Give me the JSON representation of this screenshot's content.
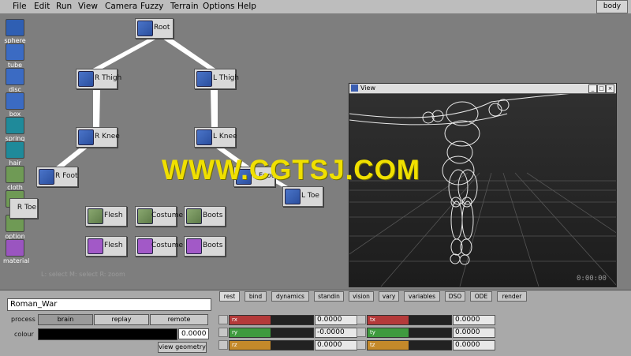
{
  "menu": [
    "File",
    "Edit",
    "Run",
    "View",
    "Camera",
    "Fuzzy",
    "Terrain",
    "Options",
    "Help"
  ],
  "body_button": "body",
  "tools": [
    {
      "label": "sphere",
      "icon": "sphere-icon",
      "color": "#2f5fb3"
    },
    {
      "label": "tube",
      "icon": "tube-icon",
      "color": "#3b6bc3"
    },
    {
      "label": "disc",
      "icon": "disc-icon",
      "color": "#3b6bc3"
    },
    {
      "label": "box",
      "icon": "box-icon",
      "color": "#3b6bc3"
    },
    {
      "label": "spring",
      "icon": "spring-icon",
      "color": "#1f8a9a"
    },
    {
      "label": "hair",
      "icon": "hair-icon",
      "color": "#1f8a9a"
    },
    {
      "label": "cloth",
      "icon": "cloth-icon",
      "color": "#6f9a55"
    },
    {
      "label": "geo",
      "icon": "geo-icon",
      "color": "#6f9a55"
    },
    {
      "label": "option",
      "icon": "option-icon",
      "color": "#6f9a55"
    },
    {
      "label": "material",
      "icon": "material-icon",
      "color": "#9a55c0"
    }
  ],
  "nodes": {
    "root": "Root",
    "r_thigh": "R Thigh",
    "l_thigh": "L Thigh",
    "r_knee": "R Knee",
    "l_knee": "L Knee",
    "r_foot": "R Foot",
    "l_foot": "L Foot",
    "r_toe": "R Toe",
    "l_toe": "L Toe",
    "geo_flesh": "Flesh",
    "geo_costume": "Costume",
    "geo_boots": "Boots",
    "mat_flesh": "Flesh",
    "mat_costume": "Costume",
    "mat_boots": "Boots"
  },
  "watermark": "WWW.CGTSJ.COM",
  "canvas_hint": "L: select   M: select   R: zoom",
  "view_window": {
    "title": "View",
    "timecode": "0:00:00"
  },
  "bottom": {
    "name_value": "Roman_War",
    "process_label": "process",
    "process_buttons": [
      "brain",
      "replay",
      "remote"
    ],
    "colour_label": "colour",
    "colour_value": "0.0000",
    "view_geometry": "view geometry"
  },
  "tabs": [
    "rest",
    "bind",
    "dynamics",
    "standin",
    "vision",
    "vary",
    "variables",
    "DSO",
    "ODE",
    "render"
  ],
  "channels_left": [
    {
      "name": "rx",
      "value": "0.0000",
      "color": "#b43a3a"
    },
    {
      "name": "ry",
      "value": "-0.0000",
      "color": "#3f9a3f"
    },
    {
      "name": "rz",
      "value": "0.0000",
      "color": "#c4892a"
    }
  ],
  "channels_right": [
    {
      "name": "tx",
      "value": "0.0000",
      "color": "#b43a3a"
    },
    {
      "name": "ty",
      "value": "0.0000",
      "color": "#3f9a3f"
    },
    {
      "name": "tz",
      "value": "0.0000",
      "color": "#c4892a"
    }
  ]
}
